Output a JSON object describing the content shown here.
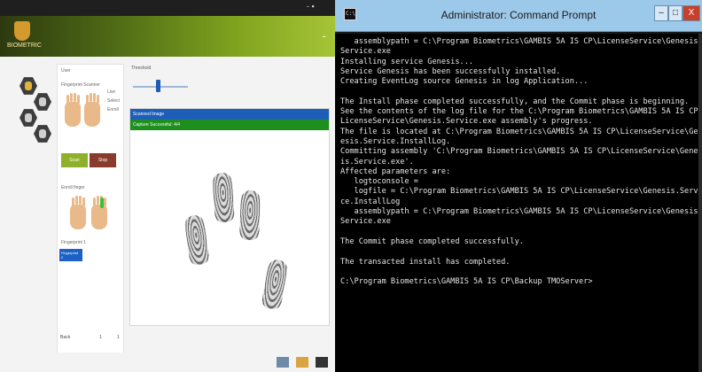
{
  "app": {
    "logo_text": "BIOMETRIC",
    "window_controls": "- ▪",
    "header_icon": "-",
    "panel": {
      "heading": "User",
      "fingerprint_section": "Fingerprint Scanner",
      "options": [
        "Live",
        "Select",
        "Enroll"
      ],
      "ok_label": "Scan",
      "cancel_label": "Stop",
      "enroll_heading": "Enroll finger",
      "list_item_1": "Fingerprint 1",
      "list_item_2": "Fingerprint 2"
    },
    "slider_label": "Threshold",
    "slider_value": 0.45,
    "scan_header_blue": "Scanned Image",
    "scan_header_green": "Capture Successful: 4/4",
    "bottom_label": "Back",
    "page_indicator": "1",
    "page_total": "1",
    "icons": [
      "app-logo-icon",
      "hex-user-icon",
      "hex-finger-icon",
      "hex-settings-icon",
      "hex-report-icon"
    ]
  },
  "cmd": {
    "title": "Administrator: Command Prompt",
    "min_label": "–",
    "max_label": "□",
    "close_label": "X",
    "lines": [
      "   assemblypath = C:\\Program Biometrics\\GAMBIS 5A IS CP\\LicenseService\\Genesis.",
      "Service.exe",
      "Installing service Genesis...",
      "Service Genesis has been successfully installed.",
      "Creating EventLog source Genesis in log Application...",
      "",
      "The Install phase completed successfully, and the Commit phase is beginning.",
      "See the contents of the log file for the C:\\Program Biometrics\\GAMBIS 5A IS CP\\",
      "LicenseService\\Genesis.Service.exe assembly's progress.",
      "The file is located at C:\\Program Biometrics\\GAMBIS 5A IS CP\\LicenseService\\Gen",
      "esis.Service.InstallLog.",
      "Committing assembly 'C:\\Program Biometrics\\GAMBIS 5A IS CP\\LicenseService\\Genes",
      "is.Service.exe'.",
      "Affected parameters are:",
      "   logtoconsole =",
      "   logfile = C:\\Program Biometrics\\GAMBIS 5A IS CP\\LicenseService\\Genesis.Servi",
      "ce.InstallLog",
      "   assemblypath = C:\\Program Biometrics\\GAMBIS 5A IS CP\\LicenseService\\Genesis.",
      "Service.exe",
      "",
      "The Commit phase completed successfully.",
      "",
      "The transacted install has completed.",
      "",
      "C:\\Program Biometrics\\GAMBIS 5A IS CP\\Backup TMOServer>"
    ]
  }
}
